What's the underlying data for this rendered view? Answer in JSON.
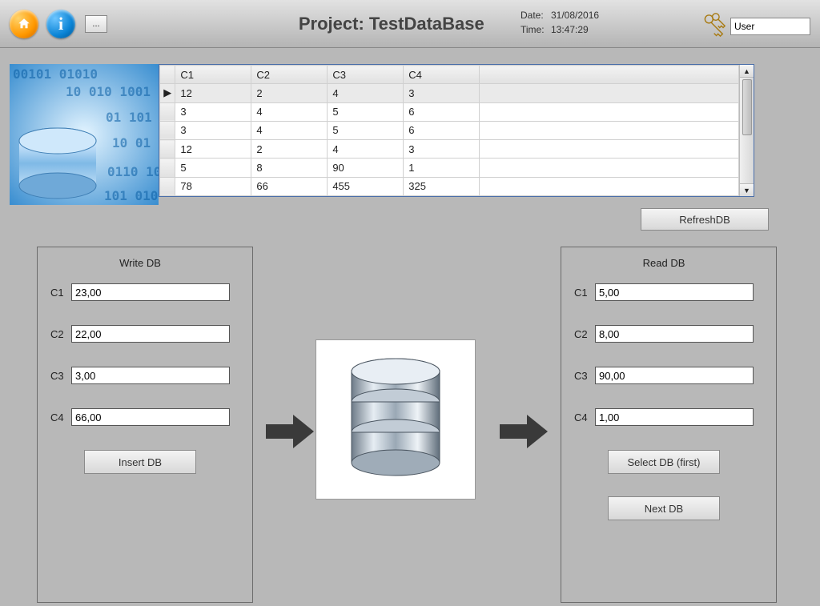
{
  "header": {
    "title": "Project: TestDataBase",
    "more_label": "...",
    "date_label": "Date:",
    "date_value": "31/08/2016",
    "time_label": "Time:",
    "time_value": "13:47:29",
    "user_value": "User"
  },
  "grid": {
    "columns": [
      "C1",
      "C2",
      "C3",
      "C4"
    ],
    "rows": [
      {
        "sel": true,
        "c": [
          "12",
          "2",
          "4",
          "3"
        ]
      },
      {
        "sel": false,
        "c": [
          "3",
          "4",
          "5",
          "6"
        ]
      },
      {
        "sel": false,
        "c": [
          "3",
          "4",
          "5",
          "6"
        ]
      },
      {
        "sel": false,
        "c": [
          "12",
          "2",
          "4",
          "3"
        ]
      },
      {
        "sel": false,
        "c": [
          "5",
          "8",
          "90",
          "1"
        ]
      },
      {
        "sel": false,
        "c": [
          "78",
          "66",
          "455",
          "325"
        ]
      }
    ]
  },
  "buttons": {
    "refresh": "RefreshDB",
    "insert": "Insert DB",
    "select_first": "Select DB (first)",
    "next": "Next DB"
  },
  "write_panel": {
    "title": "Write DB",
    "labels": [
      "C1",
      "C2",
      "C3",
      "C4"
    ],
    "values": [
      "23,00",
      "22,00",
      "3,00",
      "66,00"
    ]
  },
  "read_panel": {
    "title": "Read DB",
    "labels": [
      "C1",
      "C2",
      "C3",
      "C4"
    ],
    "values": [
      "5,00",
      "8,00",
      "90,00",
      "1,00"
    ]
  }
}
